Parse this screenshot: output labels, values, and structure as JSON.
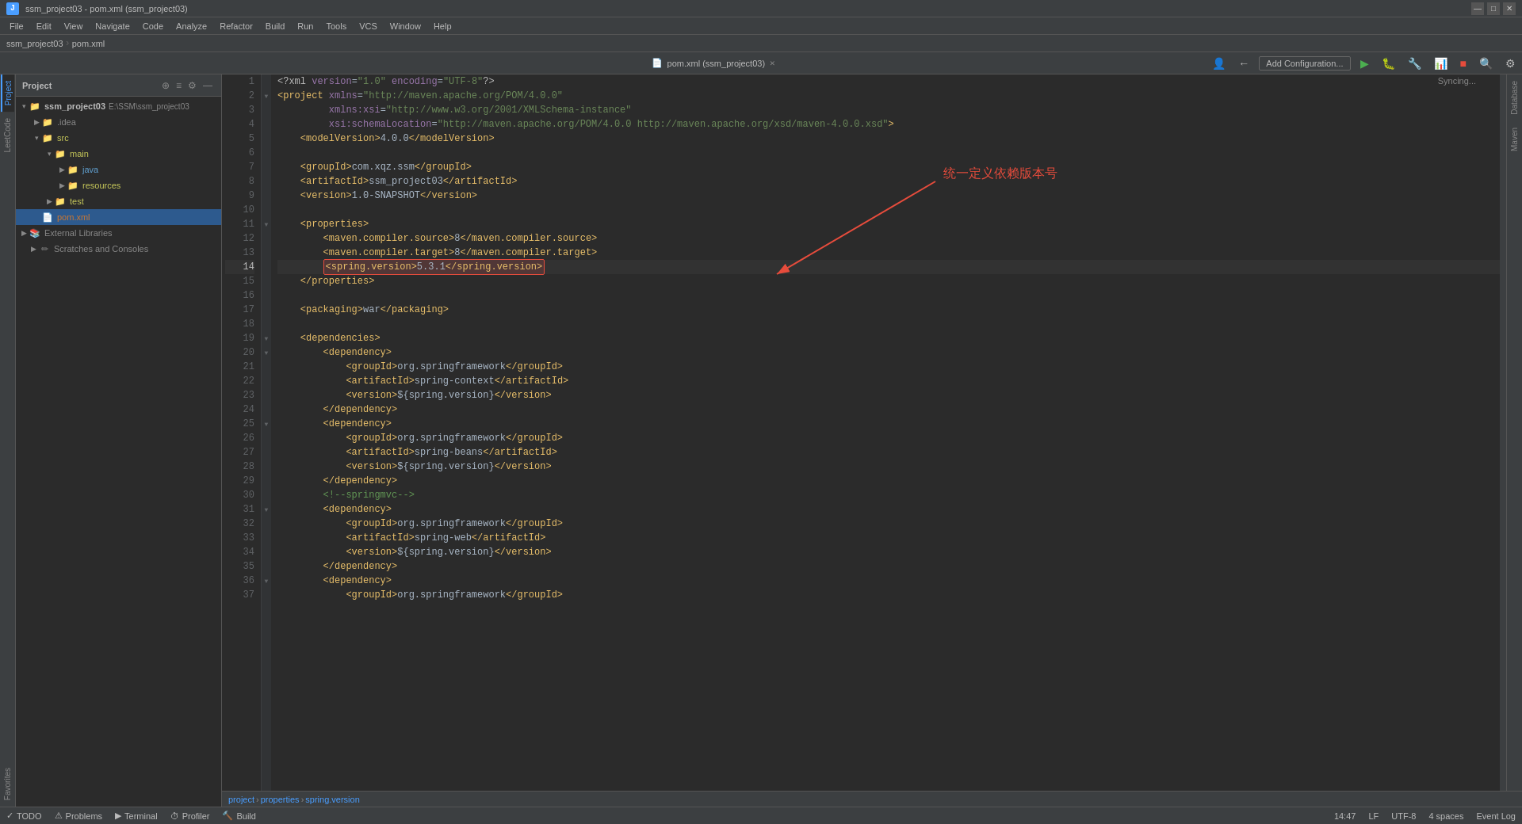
{
  "window": {
    "title": "ssm_project03 - pom.xml (ssm_project03)",
    "controls": {
      "minimize": "—",
      "maximize": "□",
      "close": "✕"
    }
  },
  "menu": {
    "items": [
      "File",
      "Edit",
      "View",
      "Navigate",
      "Code",
      "Analyze",
      "Refactor",
      "Build",
      "Run",
      "Tools",
      "VCS",
      "Window",
      "Help"
    ]
  },
  "breadcrumb": {
    "project": "ssm_project03",
    "file": "pom.xml"
  },
  "toolbar": {
    "config_btn": "Add Configuration...",
    "search_icon": "🔍"
  },
  "project_panel": {
    "title": "Project",
    "root": "ssm_project03",
    "root_path": "E:\\SSM\\ssm_project03",
    "items": [
      {
        "label": "ssm_project03",
        "type": "root",
        "expanded": true,
        "indent": 0
      },
      {
        "label": ".idea",
        "type": "folder",
        "expanded": false,
        "indent": 1
      },
      {
        "label": "src",
        "type": "folder",
        "expanded": true,
        "indent": 1
      },
      {
        "label": "main",
        "type": "folder",
        "expanded": true,
        "indent": 2
      },
      {
        "label": "java",
        "type": "folder",
        "expanded": false,
        "indent": 3
      },
      {
        "label": "resources",
        "type": "folder",
        "expanded": false,
        "indent": 3
      },
      {
        "label": "test",
        "type": "folder",
        "expanded": false,
        "indent": 2
      },
      {
        "label": "pom.xml",
        "type": "xml",
        "indent": 1,
        "selected": true
      },
      {
        "label": "External Libraries",
        "type": "folder",
        "expanded": false,
        "indent": 0
      },
      {
        "label": "Scratches and Consoles",
        "type": "scratch",
        "expanded": false,
        "indent": 0
      }
    ]
  },
  "tab": {
    "filename": "pom.xml",
    "project": "ssm_project03",
    "icon": "📄"
  },
  "editor": {
    "syncing": "Syncing...",
    "lines": [
      {
        "num": 1,
        "content": "<?xml version=\"1.0\" encoding=\"UTF-8\"?>"
      },
      {
        "num": 2,
        "content": "<project xmlns=\"http://maven.apache.org/POM/4.0.0\""
      },
      {
        "num": 3,
        "content": "         xmlns:xsi=\"http://www.w3.org/2001/XMLSchema-instance\""
      },
      {
        "num": 4,
        "content": "         xsi:schemaLocation=\"http://maven.apache.org/POM/4.0.0 http://maven.apache.org/xsd/maven-4.0.0.xsd\">"
      },
      {
        "num": 5,
        "content": "    <modelVersion>4.0.0</modelVersion>"
      },
      {
        "num": 6,
        "content": ""
      },
      {
        "num": 7,
        "content": "    <groupId>com.xqz.ssm</groupId>"
      },
      {
        "num": 8,
        "content": "    <artifactId>ssm_project03</artifactId>"
      },
      {
        "num": 9,
        "content": "    <version>1.0-SNAPSHOT</version>"
      },
      {
        "num": 10,
        "content": ""
      },
      {
        "num": 11,
        "content": "    <properties>"
      },
      {
        "num": 12,
        "content": "        <maven.compiler.source>8</maven.compiler.source>"
      },
      {
        "num": 13,
        "content": "        <maven.compiler.target>8</maven.compiler.target>"
      },
      {
        "num": 14,
        "content": "        <spring.version>5.3.1</spring.version>",
        "highlight": true
      },
      {
        "num": 15,
        "content": "    </properties>"
      },
      {
        "num": 16,
        "content": ""
      },
      {
        "num": 17,
        "content": "    <packaging>war</packaging>"
      },
      {
        "num": 18,
        "content": ""
      },
      {
        "num": 19,
        "content": "    <dependencies>"
      },
      {
        "num": 20,
        "content": "        <dependency>"
      },
      {
        "num": 21,
        "content": "            <groupId>org.springframework</groupId>"
      },
      {
        "num": 22,
        "content": "            <artifactId>spring-context</artifactId>"
      },
      {
        "num": 23,
        "content": "            <version>${spring.version}</version>"
      },
      {
        "num": 24,
        "content": "        </dependency>"
      },
      {
        "num": 25,
        "content": "        <dependency>"
      },
      {
        "num": 26,
        "content": "            <groupId>org.springframework</groupId>"
      },
      {
        "num": 27,
        "content": "            <artifactId>spring-beans</artifactId>"
      },
      {
        "num": 28,
        "content": "            <version>${spring.version}</version>"
      },
      {
        "num": 29,
        "content": "        </dependency>"
      },
      {
        "num": 30,
        "content": "        <!--springmvc-->"
      },
      {
        "num": 31,
        "content": "        <dependency>"
      },
      {
        "num": 32,
        "content": "            <groupId>org.springframework</groupId>"
      },
      {
        "num": 33,
        "content": "            <artifactId>spring-web</artifactId>"
      },
      {
        "num": 34,
        "content": "            <version>${spring.version}</version>"
      },
      {
        "num": 35,
        "content": "        </dependency>"
      },
      {
        "num": 36,
        "content": "        <dependency>"
      },
      {
        "num": 37,
        "content": "            <groupId>org.springframework</groupId>"
      }
    ]
  },
  "annotation": {
    "text": "统一定义依赖版本号",
    "color": "#e74c3c"
  },
  "statusbar": {
    "breadcrumb": "project > properties > spring.version",
    "position": "14:47",
    "encoding": "UTF-8",
    "line_separator": "LF",
    "indent": "4 spaces"
  },
  "bottom_bar": {
    "items": [
      {
        "label": "TODO",
        "icon": "✓"
      },
      {
        "label": "Problems",
        "icon": "⚠"
      },
      {
        "label": "Terminal",
        "icon": "▶"
      },
      {
        "label": "Profiler",
        "icon": "⏱"
      },
      {
        "label": "Build",
        "icon": "🔨"
      }
    ],
    "right": [
      {
        "label": "Event Log"
      }
    ]
  },
  "right_panel": {
    "database_label": "Database",
    "maven_label": "Maven"
  }
}
